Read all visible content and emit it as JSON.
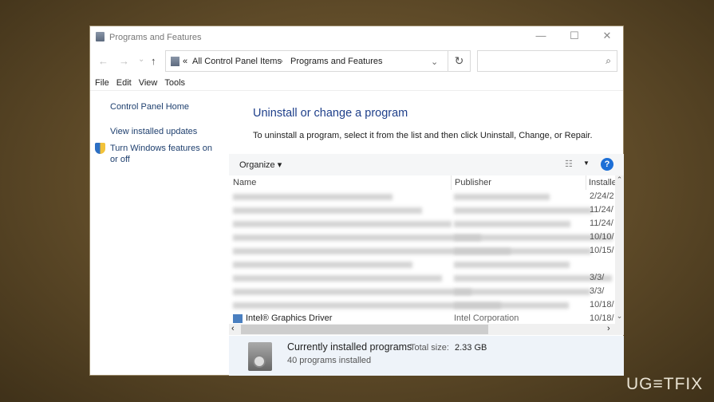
{
  "window": {
    "title": "Programs and Features",
    "minimize": "—",
    "maximize": "☐",
    "close": "✕"
  },
  "nav": {
    "back": "←",
    "forward": "→",
    "recent": "⌄",
    "up": "↑"
  },
  "address": {
    "prefix": "«",
    "crumbs": [
      "All Control Panel Items",
      "Programs and Features"
    ],
    "sep": "›",
    "dropdown": "⌄",
    "refresh": "↻"
  },
  "search": {
    "placeholder": "",
    "icon": "⌕"
  },
  "menu": [
    "File",
    "Edit",
    "View",
    "Tools"
  ],
  "sidebar": {
    "items": [
      "Control Panel Home",
      "View installed updates",
      "Turn Windows features on or off"
    ]
  },
  "main": {
    "title": "Uninstall or change a program",
    "description": "To uninstall a program, select it from the list and then click Uninstall, Change, or Repair."
  },
  "toolbar": {
    "organize": "Organize ▾",
    "view_icon": "☷",
    "view_dropdown": "▼",
    "help": "?"
  },
  "columns": [
    "Name",
    "Publisher",
    "Installe"
  ],
  "rows": [
    {
      "date": "2/24/2"
    },
    {
      "date": "11/24/"
    },
    {
      "date": "11/24/"
    },
    {
      "date": "10/10/"
    },
    {
      "date": "10/15/"
    },
    {
      "date": ""
    },
    {
      "date": "3/3/"
    },
    {
      "date": "3/3/"
    },
    {
      "date": "10/18/"
    },
    {
      "name": "Intel® Graphics Driver",
      "publisher": "Intel Corporation",
      "date": "10/18/"
    }
  ],
  "status": {
    "title": "Currently installed programs",
    "size_label": "Total size:",
    "size": "2.33 GB",
    "count": "40 programs installed"
  },
  "watermark": "UG≡TFIX"
}
